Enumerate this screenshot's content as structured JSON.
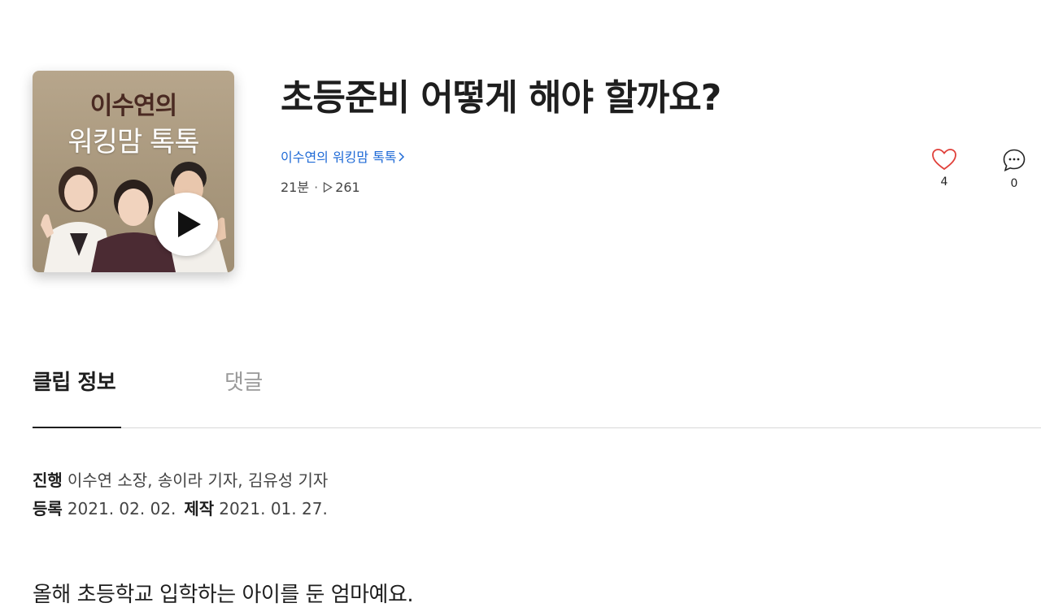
{
  "thumbnail": {
    "title_line1": "이수연의",
    "title_line2": "워킹맘 톡톡"
  },
  "clip": {
    "title": "초등준비 어떻게 해야 할까요?",
    "channel_name": "이수연의 워킹맘 톡톡",
    "duration": "21분",
    "play_count": "261",
    "likes": "4",
    "comments": "0"
  },
  "tabs": {
    "info": "클립 정보",
    "comments": "댓글"
  },
  "info": {
    "host_label": "진행",
    "host_value": "이수연 소장, 송이라 기자, 김유성 기자",
    "registered_label": "등록",
    "registered_value": "2021. 02. 02.",
    "produced_label": "제작",
    "produced_value": "2021. 01. 27."
  },
  "description": "올해 초등학교 입학하는 아이를 둔 엄마예요.",
  "colors": {
    "link": "#1f6ad6",
    "like_heart": "#e0403a",
    "text": "#1e1e1e"
  }
}
